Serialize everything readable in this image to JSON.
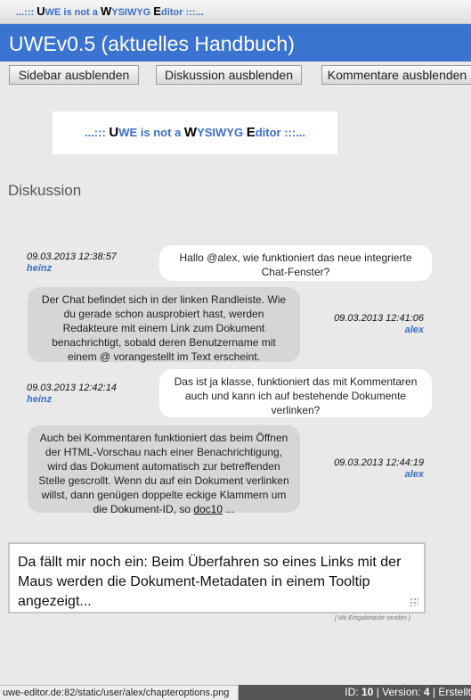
{
  "window": {
    "small_title_prefix": "...:::",
    "small_title_suffix": ":::..."
  },
  "logo": {
    "segments": [
      {
        "t": "...::: ",
        "strong": false
      },
      {
        "t": "U",
        "strong": true
      },
      {
        "t": "WE is not a ",
        "strong": false
      },
      {
        "t": "W",
        "strong": true
      },
      {
        "t": "YSIWYG ",
        "strong": false
      },
      {
        "t": "E",
        "strong": true
      },
      {
        "t": "ditor :::...",
        "strong": false
      }
    ]
  },
  "header": {
    "title": "UWEv0.5 (aktuelles Handbuch)"
  },
  "toolbar": {
    "sidebar_label": "Sidebar ausblenden",
    "diskussion_label": "Diskussion ausblenden",
    "kommentare_label": "Kommentare ausblenden"
  },
  "section": {
    "title": "Diskussion"
  },
  "messages": [
    {
      "time": "09.03.2013 12:38:57",
      "user": "heinz",
      "text": "Hallo @alex, wie funktioniert das neue integrierte Chat-Fenster?"
    },
    {
      "time": "09.03.2013 12:41:06",
      "user": "alex",
      "text": "Der Chat befindet sich in der linken Randleiste. Wie du gerade schon ausprobiert hast, werden Redakteure mit einem Link zum Dokument benachrichtigt, sobald deren Benutzername mit einem @ vorangestellt im Text erscheint."
    },
    {
      "time": "09.03.2013 12:42:14",
      "user": "heinz",
      "text": "Das ist ja klasse, funktioniert das mit Kommentaren auch und kann ich auf bestehende Dokumente verlinken?"
    },
    {
      "time": "09.03.2013 12:44:19",
      "user": "alex",
      "text": "Auch bei Kommentaren funktioniert das beim Öffnen der HTML-Vorschau nach einer Benachrichtigung, wird das Dokument automatisch zur betreffenden Stelle gescrollt. Wenn du auf ein Dokument verlinken willst, dann genügen doppelte eckige Klammern um die Dokument-ID, so ",
      "link": "doc10",
      "suffix": " ..."
    }
  ],
  "composer": {
    "value": "Da fällt mir noch ein: Beim Überfahren so eines Links mit der Maus werden die Dokument-Metadaten in einem Tooltip angezeigt...",
    "hint": "[ Mit Eingabetaste senden ]"
  },
  "statusbar": {
    "url": "uwe-editor.de:82/static/user/alex/chapteroptions.png",
    "id_label": "ID:",
    "id_value": "10",
    "version_label": "| Version:",
    "version_value": "4",
    "created_label": "| Erstellt"
  }
}
